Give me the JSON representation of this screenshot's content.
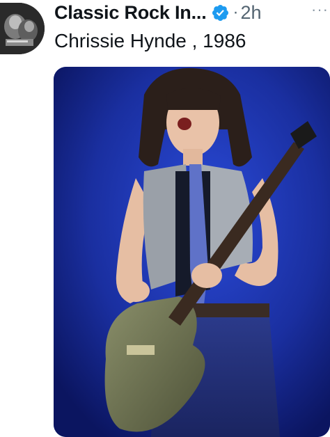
{
  "author": {
    "display_name": "Classic Rock In...",
    "verified": true,
    "timestamp": "2h",
    "separator": "·"
  },
  "tweet": {
    "text": "Chrissie Hynde , 1986"
  },
  "menu": {
    "more_label": "···"
  },
  "icons": {
    "avatar": "avatar-photo",
    "verified": "verified-badge-icon",
    "more": "more-options-icon"
  },
  "colors": {
    "verified_blue": "#1d9bf0",
    "muted_text": "#536471",
    "photo_background": "#1a2fa0"
  }
}
